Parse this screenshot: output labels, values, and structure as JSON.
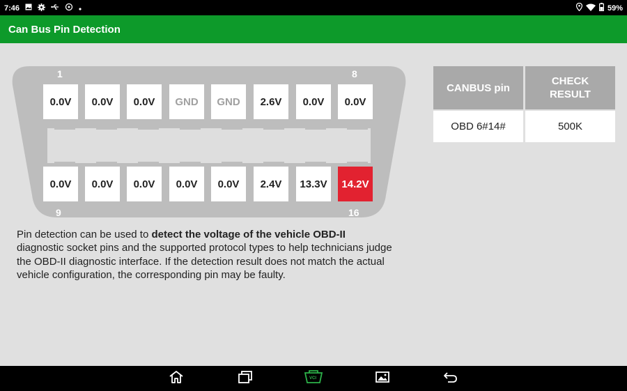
{
  "status_bar": {
    "time": "7:46",
    "battery_text": "59%",
    "left_icons": [
      "image-icon",
      "gear-icon",
      "usb-icon",
      "sync-icon",
      "dot-icon"
    ],
    "right_icons": [
      "location-icon",
      "wifi-icon",
      "battery-icon"
    ]
  },
  "header": {
    "title": "Can Bus Pin Detection",
    "color": "#0d9a2a"
  },
  "connector": {
    "top_left_label": "1",
    "top_right_label": "8",
    "bottom_left_label": "9",
    "bottom_right_label": "16",
    "top_pins": [
      {
        "value": "0.0V",
        "state": "normal"
      },
      {
        "value": "0.0V",
        "state": "normal"
      },
      {
        "value": "0.0V",
        "state": "normal"
      },
      {
        "value": "GND",
        "state": "ground"
      },
      {
        "value": "GND",
        "state": "ground"
      },
      {
        "value": "2.6V",
        "state": "normal"
      },
      {
        "value": "0.0V",
        "state": "normal"
      },
      {
        "value": "0.0V",
        "state": "normal"
      }
    ],
    "bottom_pins": [
      {
        "value": "0.0V",
        "state": "normal"
      },
      {
        "value": "0.0V",
        "state": "normal"
      },
      {
        "value": "0.0V",
        "state": "normal"
      },
      {
        "value": "0.0V",
        "state": "normal"
      },
      {
        "value": "0.0V",
        "state": "normal"
      },
      {
        "value": "2.4V",
        "state": "normal"
      },
      {
        "value": "13.3V",
        "state": "normal"
      },
      {
        "value": "14.2V",
        "state": "alert"
      }
    ],
    "alert_color": "#e22230"
  },
  "description": {
    "prefix": "Pin detection can be used to ",
    "bold": "detect the voltage of the vehicle OBD-II",
    "suffix": " diagnostic socket pins and the supported protocol types to help technicians judge the OBD-II diagnostic interface. If the detection result does not match the actual vehicle configuration, the corresponding pin may be faulty."
  },
  "result_table": {
    "headers": [
      "CANBUS pin",
      "CHECK RESULT"
    ],
    "rows": [
      [
        "OBD 6#14#",
        "500K"
      ]
    ]
  },
  "nav_bar": {
    "icons": [
      "home-icon",
      "recent-apps-icon",
      "vci-icon",
      "screenshot-icon",
      "back-icon"
    ],
    "vci_label": "VCI",
    "vci_color": "#2db34a"
  }
}
